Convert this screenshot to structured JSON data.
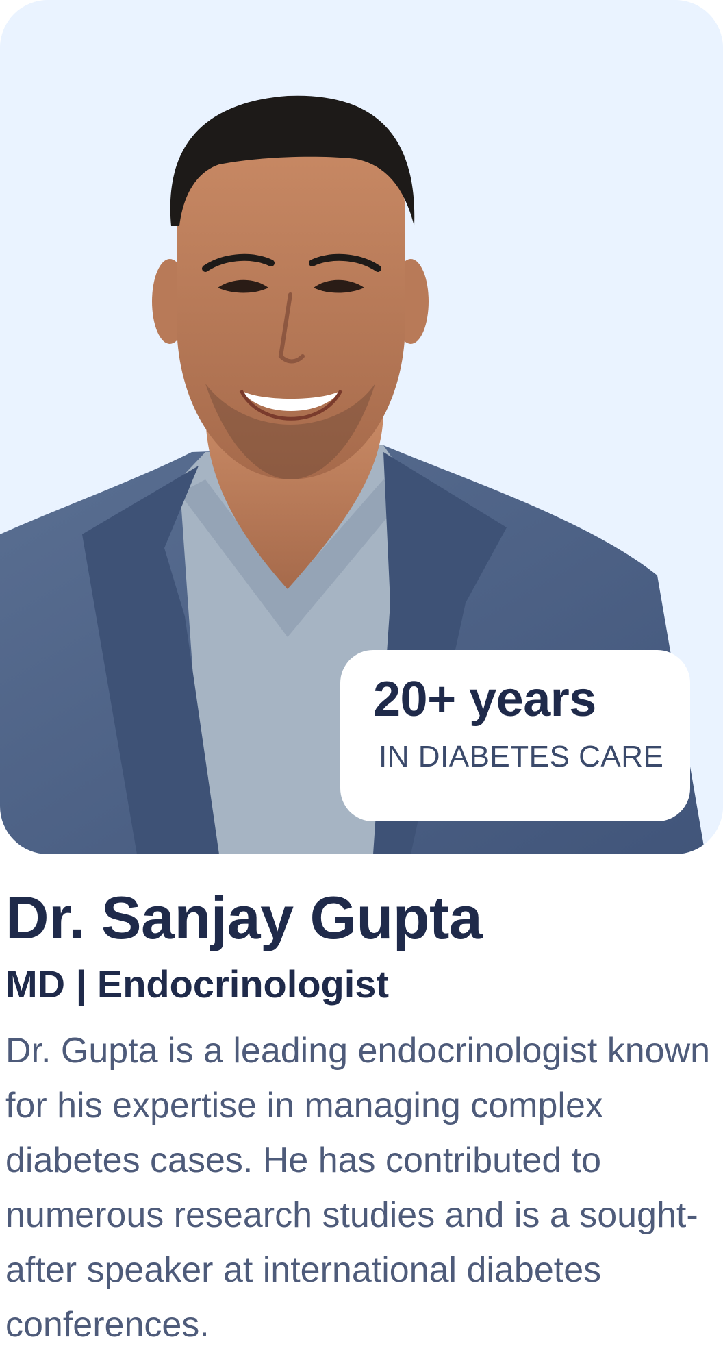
{
  "photo": {
    "alt": "Dr. Sanjay Gupta"
  },
  "badge": {
    "value": "20+ years",
    "caption": "IN DIABETES CARE"
  },
  "doctor": {
    "name": "Dr. Sanjay Gupta",
    "credentials": "MD | Endocrinologist",
    "bio": "Dr. Gupta is a leading endocrinologist known for his expertise in managing complex diabetes cases. He has contributed to numerous research studies and is a sought-after speaker at international diabetes conferences."
  },
  "colors": {
    "card_background": "#eaf3ff",
    "heading": "#1f2a4a",
    "body_text": "#4e5b7a",
    "blazer": "#4f6486",
    "shirt": "#a6b4c3"
  }
}
